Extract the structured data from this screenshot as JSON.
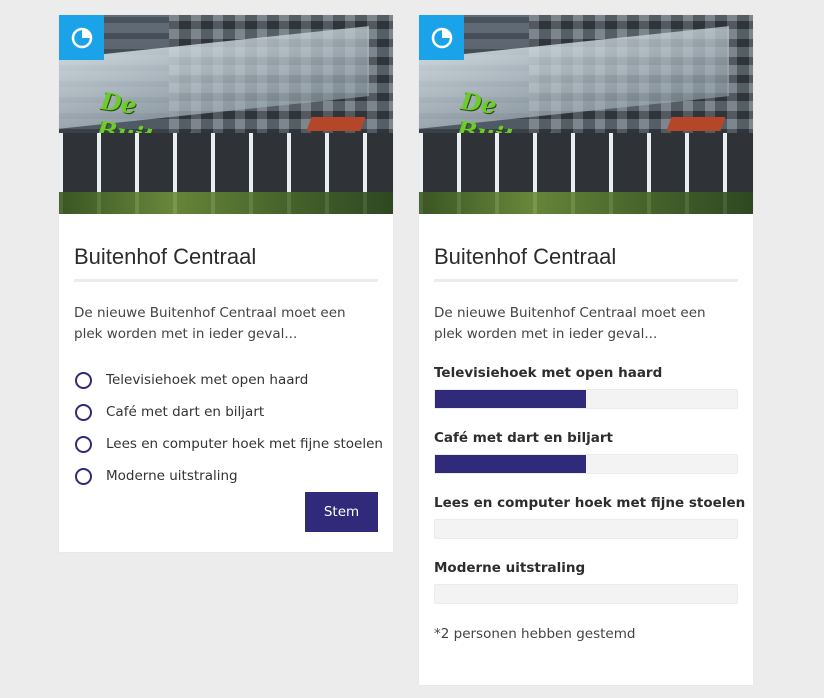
{
  "colors": {
    "accent": "#2f2a7a",
    "badge": "#1aa3e8",
    "background": "#ececec",
    "card": "#ffffff"
  },
  "poll_card": {
    "badge_icon": "pie-chart-icon",
    "image_alt": "De Buitenhof",
    "title": "Buitenhof Centraal",
    "description": "De nieuwe Buitenhof Centraal moet een plek worden met in ieder geval...",
    "options": [
      {
        "label": "Televisiehoek met open haard"
      },
      {
        "label": "Café met dart en biljart"
      },
      {
        "label": "Lees en computer hoek met fijne stoelen"
      },
      {
        "label": "Moderne uitstraling"
      }
    ],
    "vote_button": "Stem"
  },
  "results_card": {
    "badge_icon": "pie-chart-icon",
    "image_alt": "De Buitenhof",
    "title": "Buitenhof Centraal",
    "description": "De nieuwe Buitenhof Centraal moet een plek worden met in ieder geval...",
    "results": [
      {
        "label": "Televisiehoek met open haard",
        "fraction": 0.5
      },
      {
        "label": "Café met dart en biljart",
        "fraction": 0.5
      },
      {
        "label": "Lees en computer hoek met fijne stoelen",
        "fraction": 0
      },
      {
        "label": "Moderne uitstraling",
        "fraction": 0
      }
    ],
    "footnote": "*2 personen hebben gestemd"
  }
}
